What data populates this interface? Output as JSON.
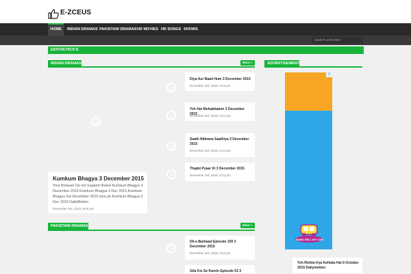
{
  "site": {
    "title": "E-ZCEUS"
  },
  "nav": {
    "items": [
      "HOME",
      "INDIAN DRAMAS",
      "PAKISTANI DRAMAS",
      "HD MOVIES",
      "HD SONGS",
      "SHOWS"
    ]
  },
  "search": {
    "placeholder": "Search and enter"
  },
  "sections": {
    "editor_picks": "EDITOR PICK'S",
    "indian_dramas": "INDIAN DRAMAS",
    "pakistani_dramas": "PAKISTANI DRAMAS",
    "advertisement": "ADVERTISEMENT",
    "more_label": "More »"
  },
  "featured": {
    "title": "Kumkum Bhagya 3 December 2015",
    "excerpt": "Your Browser Do not Support Iframe Kumkum Bhagya 3 December 2015 Kumkum Bhagya 3 Dec 2015,Kumkum Bhagya 3rd December 2015 tune.pk Kumkum Bhagya 3 Dec 2015 DailyMotion",
    "date": "December 3rd, 2015, 9:02 pm"
  },
  "indian_items": [
    {
      "title": "Diya Aur Baati Hum 3 December 2015",
      "date": "December 3rd, 2015, 9:02 pm"
    },
    {
      "title": "Yeh Hai Mohabbatein 3 December 2015",
      "date": "December 3rd, 2015, 6:21 pm"
    },
    {
      "title": "Saath Nibhana Saathiya 3 December 2015",
      "date": "December 3rd, 2015, 6:21 pm"
    },
    {
      "title": "Thapki Pyaar Ki 3 December 2015",
      "date": "December 3rd, 2015, 6:21 pm"
    }
  ],
  "pakistani_items": [
    {
      "title": "Dil-e-Barbaad Episode 159 3 December 2015",
      "date": "December 3rd, 2015, 6:54 pm"
    },
    {
      "title": "Gila Kis Se Karein Episode 53 3",
      "date": ""
    }
  ],
  "sidebar_item": {
    "title": "Yeh Rishta Kya Kehlata Hai 9 October 2015 Dailymotion"
  },
  "ad": {
    "logo_text": "BABA SELL MY CAR",
    "close": "X"
  }
}
